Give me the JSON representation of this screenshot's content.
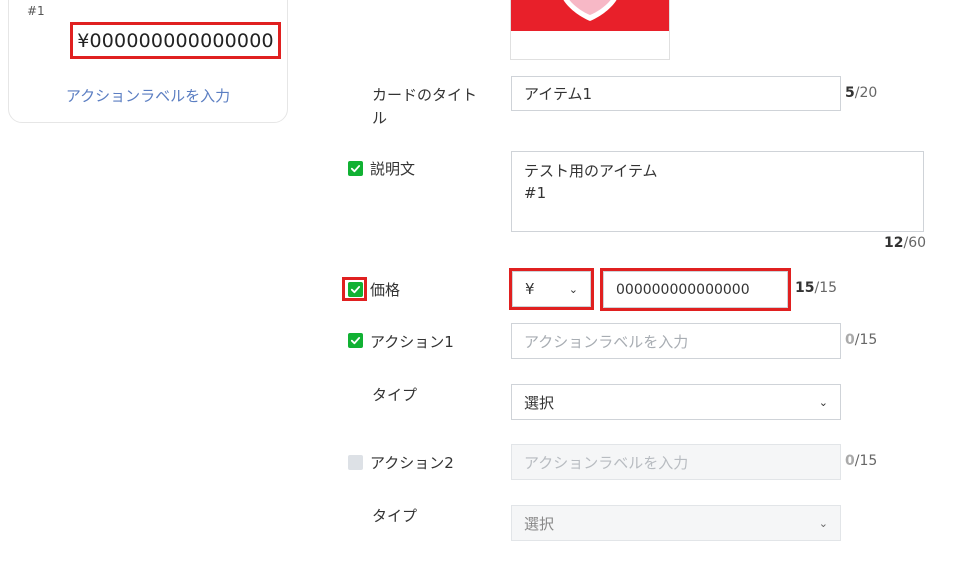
{
  "preview": {
    "number": "#1",
    "price": "¥000000000000000",
    "action_label": "アクションラベルを入力"
  },
  "form": {
    "card_title": {
      "label": "カードのタイトル",
      "value": "アイテム1",
      "count": "5",
      "max": "/20"
    },
    "description": {
      "label": "説明文",
      "line1": "テスト用のアイテム",
      "line2": "#1",
      "count": "12",
      "max": "/60"
    },
    "price": {
      "label": "価格",
      "currency": "¥",
      "value": "000000000000000",
      "count": "15",
      "max": "/15"
    },
    "action1": {
      "label": "アクション1",
      "placeholder": "アクションラベルを入力",
      "count": "0",
      "max": "/15",
      "type_label": "タイプ",
      "type_value": "選択"
    },
    "action2": {
      "label": "アクション2",
      "placeholder": "アクションラベルを入力",
      "count": "0",
      "max": "/15",
      "type_label": "タイプ",
      "type_value": "選択"
    }
  },
  "icons": {
    "checkbox_on": "check-icon",
    "chevron": "chevron-down-icon"
  },
  "colors": {
    "checkbox_green": "#11b133",
    "highlight_red": "#e02020",
    "link_blue": "#5b7ec2"
  }
}
